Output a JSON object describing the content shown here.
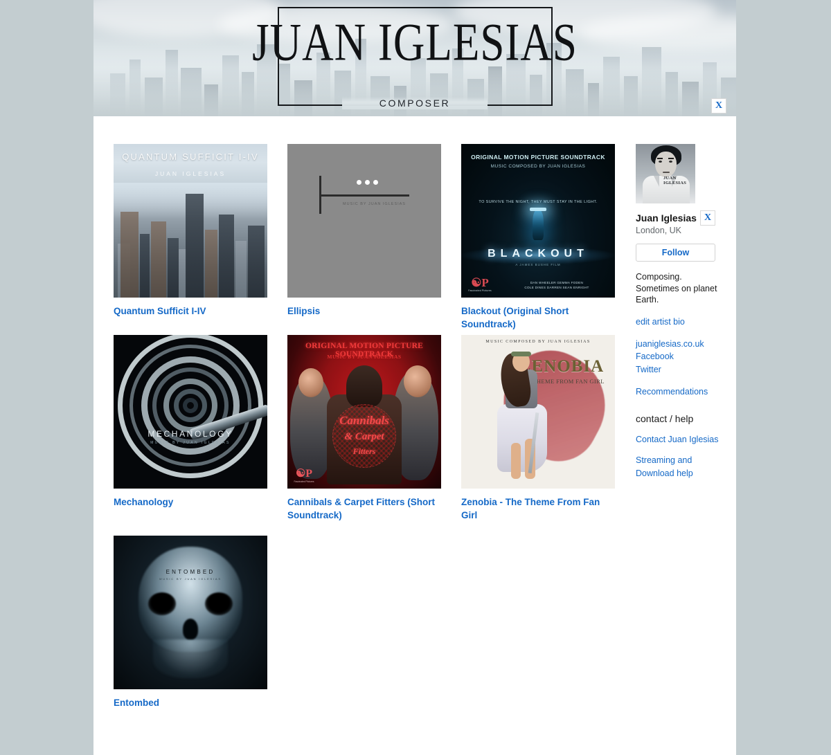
{
  "banner": {
    "logo_title": "JUAN IGLESIAS",
    "logo_subtitle": "COMPOSER",
    "close_label": "X"
  },
  "albums": [
    {
      "title": "Quantum Sufficit I-IV",
      "art": {
        "kind": "quantum",
        "title_text": "QUANTUM SUFFICIT I-IV",
        "credit_text": "JUAN IGLESIAS"
      }
    },
    {
      "title": "Ellipsis",
      "art": {
        "kind": "ellipsis",
        "credit_text": "MUSIC BY JUAN IGLESIAS"
      }
    },
    {
      "title": "Blackout (Original Short Soundtrack)",
      "art": {
        "kind": "blackout",
        "line1": "ORIGINAL MOTION PICTURE SOUNDTRACK",
        "line2": "MUSIC COMPOSED BY JUAN IGLESIAS",
        "tagline": "TO SURVIVE THE NIGHT, THEY MUST STAY IN THE LIGHT.",
        "title_text": "BLACKOUT",
        "director": "A JAMES BUSHE FILM",
        "credits": "DAN WHEELER  GEMMA FODEN\nCOLE DINES  DARREN SEAN ENRIGHT",
        "studio": "Fascinated Pictures"
      }
    },
    {
      "title": "Mechanology",
      "art": {
        "kind": "mechanology",
        "title_text": "MECHANOLOGY",
        "credit_text": "MUSIC BY JUAN IGLESIAS"
      }
    },
    {
      "title": "Cannibals & Carpet Fitters (Short Soundtrack)",
      "art": {
        "kind": "cannibals",
        "line1": "ORIGINAL MOTION PICTURE SOUNDTRACK",
        "line2": "MUSIC BY JUAN IGLESIAS",
        "name_line1": "Cannibals",
        "name_line2": "& Carpet",
        "name_line3": "Fitters",
        "studio": "Fascinated Pictures"
      }
    },
    {
      "title": "Zenobia - The Theme From Fan Girl",
      "art": {
        "kind": "zenobia",
        "top_line": "MUSIC COMPOSED BY JUAN IGLESIAS",
        "title_text": "ZENOBIA",
        "subtitle_text": "THE THEME FROM FAN GIRL"
      }
    },
    {
      "title": "Entombed",
      "art": {
        "kind": "entombed",
        "title_text": "ENTOMBED",
        "credit_text": "MUSIC BY JUAN IGLESIAS"
      }
    }
  ],
  "sidebar": {
    "avatar_signature": "JUAN IGLESIAS",
    "avatar_close_label": "X",
    "name": "Juan Iglesias",
    "location": "London, UK",
    "follow_label": "Follow",
    "bio": "Composing. Sometimes on planet Earth.",
    "edit_bio_label": "edit artist bio",
    "links": [
      {
        "label": "juaniglesias.co.uk"
      },
      {
        "label": "Facebook"
      },
      {
        "label": "Twitter"
      }
    ],
    "recommendations_label": "Recommendations",
    "contact_heading": "contact / help",
    "contact_label": "Contact Juan Iglesias",
    "streaming_label": "Streaming and Download help"
  },
  "colors": {
    "page_bg": "#c3cdd0",
    "content_bg": "#ffffff",
    "link": "#1569c7",
    "text": "#1b1b1b",
    "muted": "#62676b"
  }
}
